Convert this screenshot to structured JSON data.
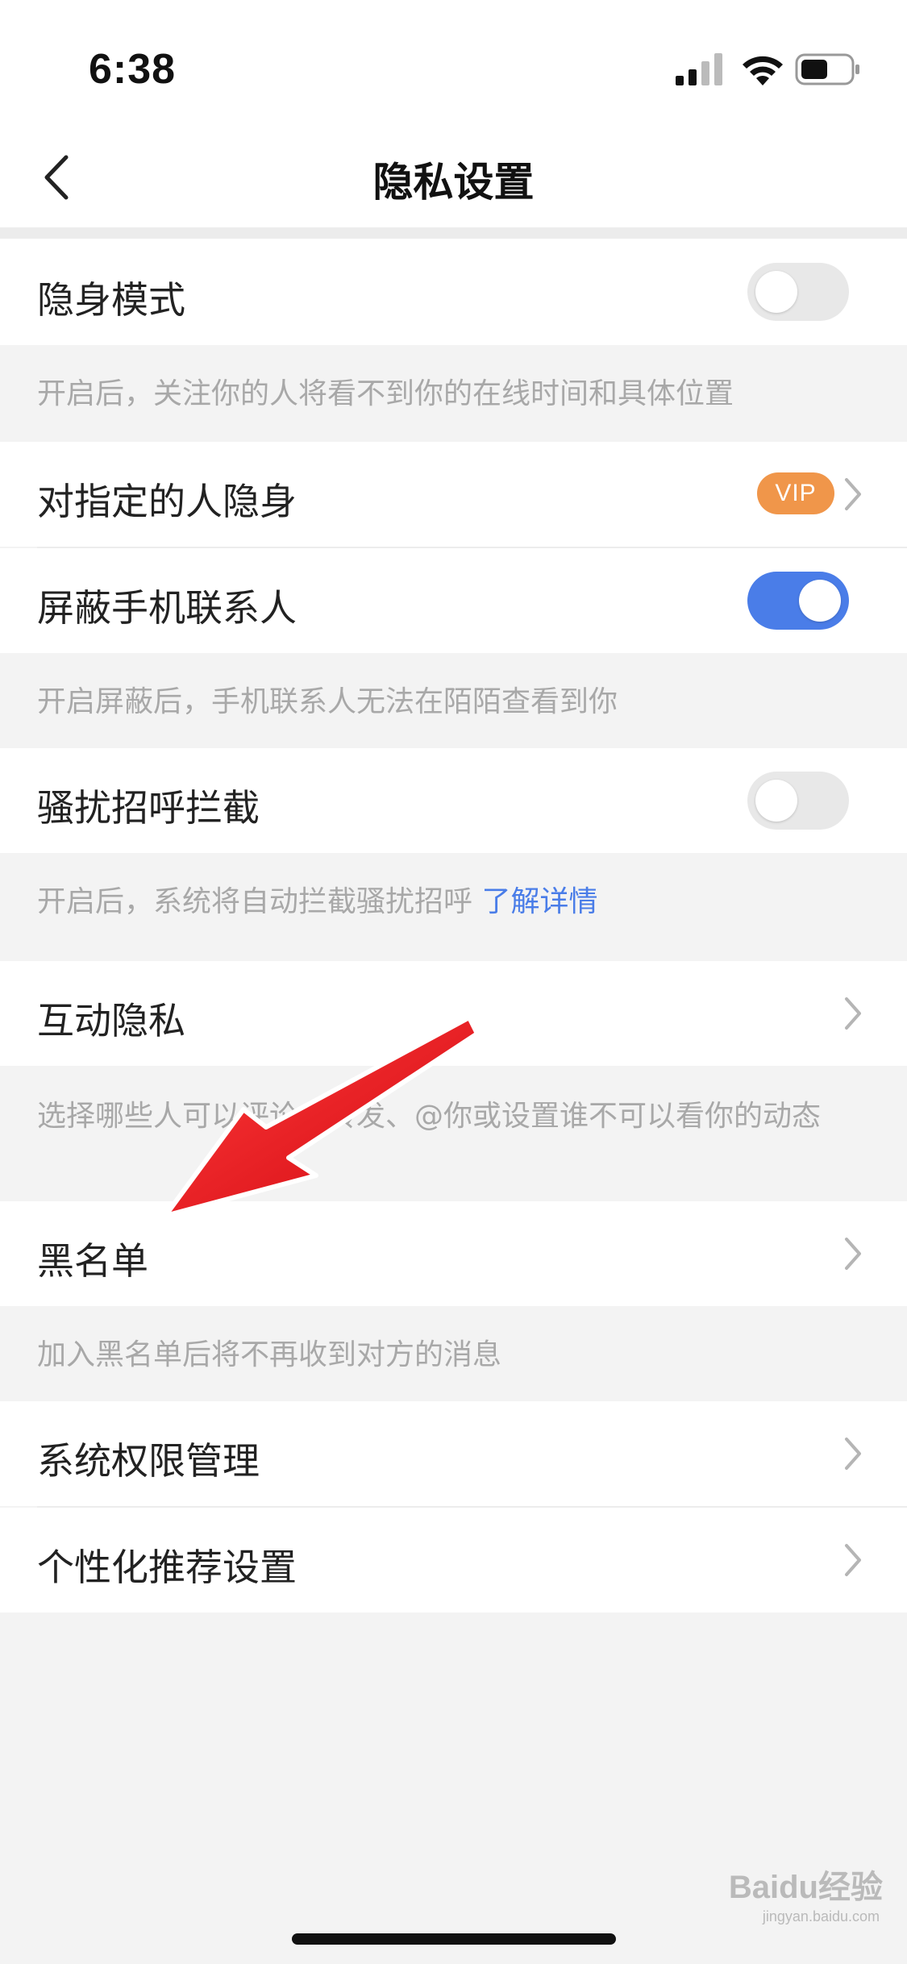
{
  "status_bar": {
    "time": "6:38"
  },
  "nav": {
    "title": "隐私设置"
  },
  "rows": {
    "stealth_mode": {
      "label": "隐身模式",
      "toggle": "off"
    },
    "stealth_hint": "开启后，关注你的人将看不到你的在线时间和具体位置",
    "stealth_specific": {
      "label": "对指定的人隐身",
      "badge": "VIP"
    },
    "block_contacts": {
      "label": "屏蔽手机联系人",
      "toggle": "on"
    },
    "block_contacts_hint": "开启屏蔽后，手机联系人无法在陌陌查看到你",
    "harass_block": {
      "label": "骚扰招呼拦截",
      "toggle": "off"
    },
    "harass_hint": "开启后，系统将自动拦截骚扰招呼",
    "harass_hint_link": "了解详情",
    "interaction_privacy": {
      "label": "互动隐私"
    },
    "interaction_hint": "选择哪些人可以评论、转发、@你或设置谁不可以看你的动态",
    "blacklist": {
      "label": "黑名单"
    },
    "blacklist_hint": "加入黑名单后将不再收到对方的消息",
    "system_permissions": {
      "label": "系统权限管理"
    },
    "personalized_recs": {
      "label": "个性化推荐设置"
    }
  },
  "watermark": {
    "brand": "Baidu经验",
    "url": "jingyan.baidu.com"
  },
  "colors": {
    "accent": "#4a7de8",
    "vip": "#f0964a",
    "arrow": "#e8141c"
  }
}
